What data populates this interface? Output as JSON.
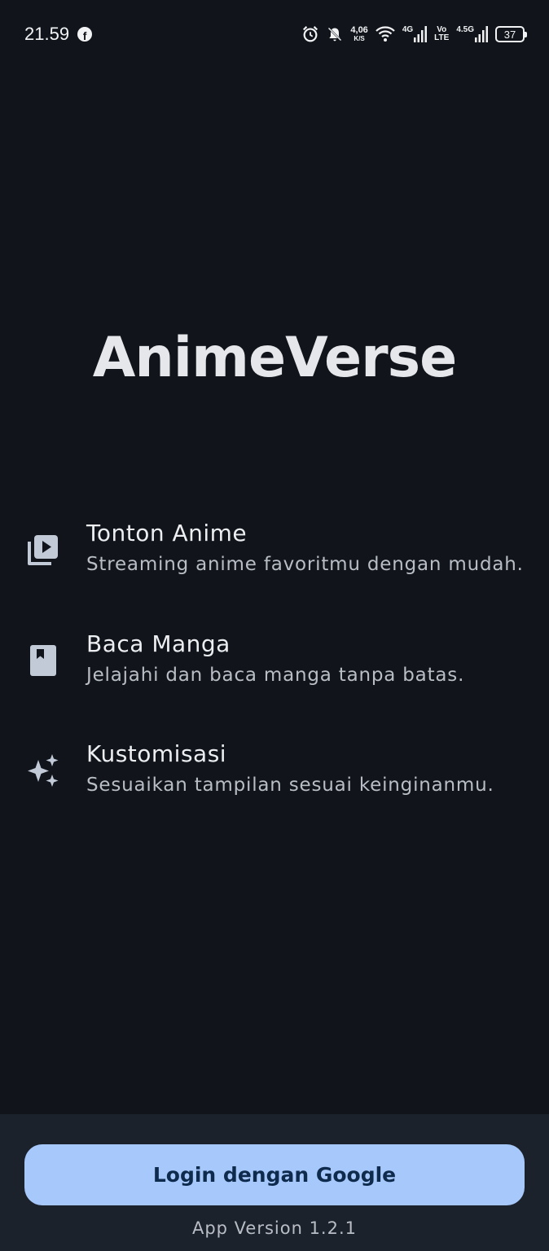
{
  "status_bar": {
    "time": "21.59",
    "app_notification_icon": "facebook-icon",
    "net_speed_value": "4,06",
    "net_speed_unit": "K/S",
    "network_label_1": "4G",
    "volte_top": "Vo",
    "volte_bottom": "LTE",
    "network_label_2": "4.5G",
    "battery_level": "37"
  },
  "app": {
    "title": "AnimeVerse"
  },
  "features": [
    {
      "icon": "video-library-icon",
      "title": "Tonton Anime",
      "description": "Streaming anime favoritmu dengan mudah."
    },
    {
      "icon": "book-icon",
      "title": "Baca Manga",
      "description": "Jelajahi dan baca manga tanpa batas."
    },
    {
      "icon": "sparkles-icon",
      "title": "Kustomisasi",
      "description": "Sesuaikan tampilan sesuai keinginanmu."
    }
  ],
  "bottom": {
    "login_label": "Login dengan Google",
    "version_text": "App Version 1.2.1"
  },
  "colors": {
    "background": "#11151b",
    "panel": "#1c222b",
    "button": "#a7c8fb",
    "button_text": "#0e2a4c",
    "icon": "#c2cad8"
  }
}
